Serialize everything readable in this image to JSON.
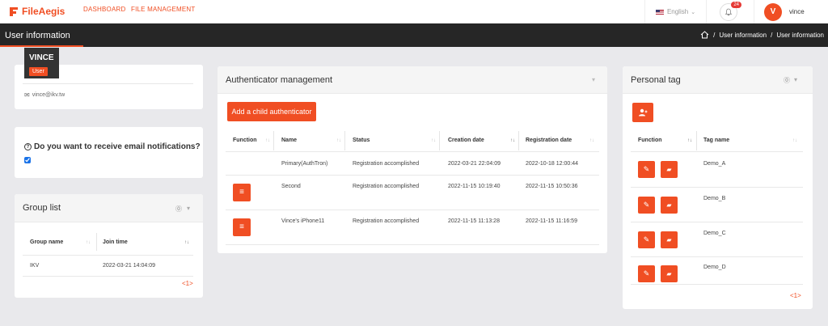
{
  "brand": {
    "name": "FileAegis"
  },
  "nav": {
    "dashboard": "DASHBOARD",
    "file_management": "FILE MANAGEMENT"
  },
  "header": {
    "language": "English",
    "notifications": "24",
    "avatar_letter": "V",
    "username": "vince"
  },
  "titlebar": {
    "title": "User information",
    "crumb1": "User information",
    "crumb2": "User information"
  },
  "profile": {
    "name": "VINCE",
    "role": "User",
    "email": "vince@ikv.tw"
  },
  "notify": {
    "question": "Do you want to receive email notifications?"
  },
  "group": {
    "title": "Group list",
    "col_name": "Group name",
    "col_time": "Join time",
    "rows": [
      {
        "name": "IKV",
        "time": "2022-03-21 14:04:09"
      }
    ],
    "pagination": "<1>"
  },
  "auth": {
    "title": "Authenticator management",
    "add_label": "Add a child authenticator",
    "cols": {
      "function": "Function",
      "name": "Name",
      "status": "Status",
      "created": "Creation date",
      "registered": "Registration date"
    },
    "rows": [
      {
        "name": "Primary(AuthTron)",
        "status": "Registration accomplished",
        "created": "2022-03-21 22:04:09",
        "registered": "2022-10-18 12:00:44"
      },
      {
        "name": "Second",
        "status": "Registration accomplished",
        "created": "2022-11-15 10:19:40",
        "registered": "2022-11-15 10:50:36"
      },
      {
        "name": "Vince's iPhone11",
        "status": "Registration accomplished",
        "created": "2022-11-15 11:13:28",
        "registered": "2022-11-15 11:16:59"
      }
    ]
  },
  "tags": {
    "title": "Personal tag",
    "col_function": "Function",
    "col_name": "Tag name",
    "rows": [
      "Demo_A",
      "Demo_B",
      "Demo_C",
      "Demo_D"
    ],
    "pagination": "<1>"
  },
  "colors": {
    "accent": "#f04e23",
    "dark": "#262626"
  }
}
